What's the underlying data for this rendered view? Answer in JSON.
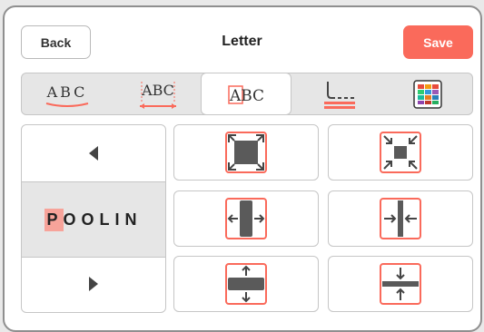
{
  "header": {
    "back_label": "Back",
    "title": "Letter",
    "save_label": "Save"
  },
  "colors": {
    "accent": "#fa6a5b",
    "selection": "#f7a39a",
    "panel_gray": "#e6e6e6",
    "border": "#c6c6c6"
  },
  "tabs": [
    {
      "name": "curve-text",
      "label": "ABC"
    },
    {
      "name": "letter-spacing",
      "label": "ABC"
    },
    {
      "name": "letter-size",
      "label": "ABC",
      "active": true
    },
    {
      "name": "baseline-align",
      "icon": "baseline-underline-icon"
    },
    {
      "name": "color-palette",
      "icon": "color-grid-icon"
    }
  ],
  "letter_selector": {
    "word_first": "P",
    "word_rest": "OOLIN",
    "prev_icon": "triangle-left-icon",
    "next_icon": "triangle-right-icon"
  },
  "resize_buttons": [
    {
      "name": "enlarge-all-button",
      "icon": "expand-all-icon"
    },
    {
      "name": "shrink-all-button",
      "icon": "shrink-all-icon"
    },
    {
      "name": "widen-button",
      "icon": "expand-horizontal-icon"
    },
    {
      "name": "narrow-button",
      "icon": "shrink-horizontal-icon"
    },
    {
      "name": "heighten-button",
      "icon": "expand-vertical-icon"
    },
    {
      "name": "shorten-button",
      "icon": "shrink-vertical-icon"
    }
  ]
}
